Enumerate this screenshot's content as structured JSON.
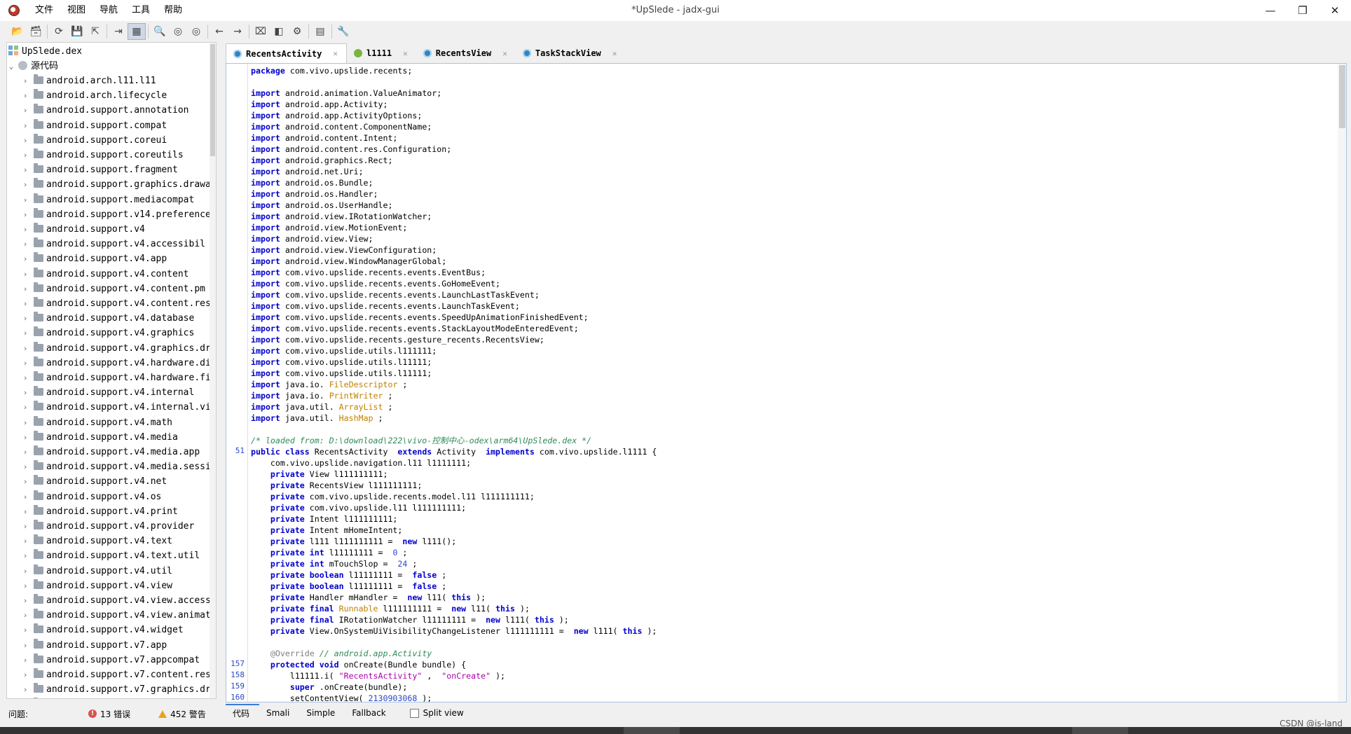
{
  "window": {
    "title": "*UpSlede - jadx-gui"
  },
  "menu": [
    "文件",
    "视图",
    "导航",
    "工具",
    "帮助"
  ],
  "window_controls": {
    "minimize": "—",
    "restore": "❐",
    "close": "✕"
  },
  "toolbar": {
    "icons": [
      "open-icon",
      "add-files-icon",
      "refresh-icon",
      "save-icon",
      "export-icon",
      "sync-tree-icon",
      "flatten-packages-icon",
      "search-icon",
      "find-class-icon",
      "find-usage-icon",
      "back-icon",
      "forward-icon",
      "deobfuscation-icon",
      "auto-save-icon",
      "debug-icon",
      "log-viewer-icon",
      "preferences-icon"
    ],
    "glyphs": [
      "📂",
      "🗃",
      "⟳",
      "💾",
      "⇱",
      "⇥",
      "▦",
      "🔍",
      "◎",
      "◎",
      "←",
      "→",
      "⌧",
      "◧",
      "⚙",
      "▤",
      "🔧"
    ]
  },
  "tree": {
    "root": "UpSlede.dex",
    "source": "源代码",
    "packages": [
      "android.arch.l11.l11",
      "android.arch.lifecycle",
      "android.support.annotation",
      "android.support.compat",
      "android.support.coreui",
      "android.support.coreutils",
      "android.support.fragment",
      "android.support.graphics.drawa",
      "android.support.mediacompat",
      "android.support.v14.preference",
      "android.support.v4",
      "android.support.v4.accessibil",
      "android.support.v4.app",
      "android.support.v4.content",
      "android.support.v4.content.pm",
      "android.support.v4.content.res",
      "android.support.v4.database",
      "android.support.v4.graphics",
      "android.support.v4.graphics.dr",
      "android.support.v4.hardware.di",
      "android.support.v4.hardware.fi",
      "android.support.v4.internal",
      "android.support.v4.internal.vi",
      "android.support.v4.math",
      "android.support.v4.media",
      "android.support.v4.media.app",
      "android.support.v4.media.sessi",
      "android.support.v4.net",
      "android.support.v4.os",
      "android.support.v4.print",
      "android.support.v4.provider",
      "android.support.v4.text",
      "android.support.v4.text.util",
      "android.support.v4.util",
      "android.support.v4.view",
      "android.support.v4.view.access",
      "android.support.v4.view.animat",
      "android.support.v4.widget",
      "android.support.v7.app",
      "android.support.v7.appcompat",
      "android.support.v7.content.res",
      "android.support.v7.graphics.dr",
      "android.support.v7.internal"
    ]
  },
  "tabs": [
    {
      "label": "RecentsActivity",
      "icon": "c",
      "active": true
    },
    {
      "label": "l1111",
      "icon": "i",
      "active": false
    },
    {
      "label": "RecentsView",
      "icon": "c",
      "active": false
    },
    {
      "label": "TaskStackView",
      "icon": "c",
      "active": false
    }
  ],
  "code": {
    "lines": [
      [
        "",
        [
          [
            "kw",
            "package"
          ],
          [
            "",
            "com.vivo.upslide.recents;"
          ]
        ]
      ],
      [
        "",
        []
      ],
      [
        "",
        [
          [
            "kw",
            "import"
          ],
          [
            "",
            "android.animation.ValueAnimator;"
          ]
        ]
      ],
      [
        "",
        [
          [
            "kw",
            "import"
          ],
          [
            "",
            "android.app.Activity;"
          ]
        ]
      ],
      [
        "",
        [
          [
            "kw",
            "import"
          ],
          [
            "",
            "android.app.ActivityOptions;"
          ]
        ]
      ],
      [
        "",
        [
          [
            "kw",
            "import"
          ],
          [
            "",
            "android.content.ComponentName;"
          ]
        ]
      ],
      [
        "",
        [
          [
            "kw",
            "import"
          ],
          [
            "",
            "android.content.Intent;"
          ]
        ]
      ],
      [
        "",
        [
          [
            "kw",
            "import"
          ],
          [
            "",
            "android.content.res.Configuration;"
          ]
        ]
      ],
      [
        "",
        [
          [
            "kw",
            "import"
          ],
          [
            "",
            "android.graphics.Rect;"
          ]
        ]
      ],
      [
        "",
        [
          [
            "kw",
            "import"
          ],
          [
            "",
            "android.net.Uri;"
          ]
        ]
      ],
      [
        "",
        [
          [
            "kw",
            "import"
          ],
          [
            "",
            "android.os.Bundle;"
          ]
        ]
      ],
      [
        "",
        [
          [
            "kw",
            "import"
          ],
          [
            "",
            "android.os.Handler;"
          ]
        ]
      ],
      [
        "",
        [
          [
            "kw",
            "import"
          ],
          [
            "",
            "android.os.UserHandle;"
          ]
        ]
      ],
      [
        "",
        [
          [
            "kw",
            "import"
          ],
          [
            "",
            "android.view.IRotationWatcher;"
          ]
        ]
      ],
      [
        "",
        [
          [
            "kw",
            "import"
          ],
          [
            "",
            "android.view.MotionEvent;"
          ]
        ]
      ],
      [
        "",
        [
          [
            "kw",
            "import"
          ],
          [
            "",
            "android.view.View;"
          ]
        ]
      ],
      [
        "",
        [
          [
            "kw",
            "import"
          ],
          [
            "",
            "android.view.ViewConfiguration;"
          ]
        ]
      ],
      [
        "",
        [
          [
            "kw",
            "import"
          ],
          [
            "",
            "android.view.WindowManagerGlobal;"
          ]
        ]
      ],
      [
        "",
        [
          [
            "kw",
            "import"
          ],
          [
            "",
            "com.vivo.upslide.recents.events.EventBus;"
          ]
        ]
      ],
      [
        "",
        [
          [
            "kw",
            "import"
          ],
          [
            "",
            "com.vivo.upslide.recents.events.GoHomeEvent;"
          ]
        ]
      ],
      [
        "",
        [
          [
            "kw",
            "import"
          ],
          [
            "",
            "com.vivo.upslide.recents.events.LaunchLastTaskEvent;"
          ]
        ]
      ],
      [
        "",
        [
          [
            "kw",
            "import"
          ],
          [
            "",
            "com.vivo.upslide.recents.events.LaunchTaskEvent;"
          ]
        ]
      ],
      [
        "",
        [
          [
            "kw",
            "import"
          ],
          [
            "",
            "com.vivo.upslide.recents.events.SpeedUpAnimationFinishedEvent;"
          ]
        ]
      ],
      [
        "",
        [
          [
            "kw",
            "import"
          ],
          [
            "",
            "com.vivo.upslide.recents.events.StackLayoutModeEnteredEvent;"
          ]
        ]
      ],
      [
        "",
        [
          [
            "kw",
            "import"
          ],
          [
            "",
            "com.vivo.upslide.recents.gesture_recents.RecentsView;"
          ]
        ]
      ],
      [
        "",
        [
          [
            "kw",
            "import"
          ],
          [
            "",
            "com.vivo.upslide.utils.l111111;"
          ]
        ]
      ],
      [
        "",
        [
          [
            "kw",
            "import"
          ],
          [
            "",
            "com.vivo.upslide.utils.l11111;"
          ]
        ]
      ],
      [
        "",
        [
          [
            "kw",
            "import"
          ],
          [
            "",
            "com.vivo.upslide.utils.l11111;"
          ]
        ]
      ],
      [
        "",
        [
          [
            "kw",
            "import"
          ],
          [
            "",
            "java.io."
          ],
          [
            "ty",
            "FileDescriptor"
          ],
          [
            "",
            ";"
          ]
        ]
      ],
      [
        "",
        [
          [
            "kw",
            "import"
          ],
          [
            "",
            "java.io."
          ],
          [
            "ty",
            "PrintWriter"
          ],
          [
            "",
            ";"
          ]
        ]
      ],
      [
        "",
        [
          [
            "kw",
            "import"
          ],
          [
            "",
            "java.util."
          ],
          [
            "ty",
            "ArrayList"
          ],
          [
            "",
            ";"
          ]
        ]
      ],
      [
        "",
        [
          [
            "kw",
            "import"
          ],
          [
            "",
            "java.util."
          ],
          [
            "ty",
            "HashMap"
          ],
          [
            "",
            ";"
          ]
        ]
      ],
      [
        "",
        []
      ],
      [
        "",
        [
          [
            "cm",
            "/* loaded from: D:\\download\\222\\vivo-控制中心-odex\\arm64\\UpSlede.dex */"
          ]
        ]
      ],
      [
        "51",
        [
          [
            "kw",
            "public class"
          ],
          [
            "",
            "RecentsActivity "
          ],
          [
            "kw",
            "extends"
          ],
          [
            "",
            "Activity "
          ],
          [
            "kw",
            "implements"
          ],
          [
            "",
            "com.vivo.upslide.l1111 {"
          ]
        ]
      ],
      [
        "",
        [
          [
            "",
            "    com.vivo.upslide.navigation.l11 l1111111;"
          ]
        ]
      ],
      [
        "",
        [
          [
            "kw",
            "    private"
          ],
          [
            "",
            "View l111111111;"
          ]
        ]
      ],
      [
        "",
        [
          [
            "kw",
            "    private"
          ],
          [
            "",
            "RecentsView l111111111;"
          ]
        ]
      ],
      [
        "",
        [
          [
            "kw",
            "    private"
          ],
          [
            "",
            "com.vivo.upslide.recents.model.l11 l111111111;"
          ]
        ]
      ],
      [
        "",
        [
          [
            "kw",
            "    private"
          ],
          [
            "",
            "com.vivo.upslide.l11 l111111111;"
          ]
        ]
      ],
      [
        "",
        [
          [
            "kw",
            "    private"
          ],
          [
            "",
            "Intent l111111111;"
          ]
        ]
      ],
      [
        "",
        [
          [
            "kw",
            "    private"
          ],
          [
            "",
            "Intent mHomeIntent;"
          ]
        ]
      ],
      [
        "",
        [
          [
            "kw",
            "    private"
          ],
          [
            "",
            "l111 l111111111 = "
          ],
          [
            "kw",
            "new"
          ],
          [
            "",
            "l111();"
          ]
        ]
      ],
      [
        "",
        [
          [
            "kw",
            "    private int"
          ],
          [
            "",
            "l11111111 = "
          ],
          [
            "num",
            "0"
          ],
          [
            "",
            ";"
          ]
        ]
      ],
      [
        "",
        [
          [
            "kw",
            "    private int"
          ],
          [
            "",
            "mTouchSlop = "
          ],
          [
            "num",
            "24"
          ],
          [
            "",
            ";"
          ]
        ]
      ],
      [
        "",
        [
          [
            "kw",
            "    private boolean"
          ],
          [
            "",
            "l11111111 = "
          ],
          [
            "kw",
            "false"
          ],
          [
            "",
            ";"
          ]
        ]
      ],
      [
        "",
        [
          [
            "kw",
            "    private boolean"
          ],
          [
            "",
            "l11111111 = "
          ],
          [
            "kw",
            "false"
          ],
          [
            "",
            ";"
          ]
        ]
      ],
      [
        "",
        [
          [
            "kw",
            "    private"
          ],
          [
            "",
            "Handler mHandler = "
          ],
          [
            "kw",
            "new"
          ],
          [
            "",
            "l11("
          ],
          [
            "kw",
            "this"
          ],
          [
            "",
            ");"
          ]
        ]
      ],
      [
        "",
        [
          [
            "kw",
            "    private final"
          ],
          [
            "ty",
            "Runnable"
          ],
          [
            "",
            "l111111111 = "
          ],
          [
            "kw",
            "new"
          ],
          [
            "",
            "l11("
          ],
          [
            "kw",
            "this"
          ],
          [
            "",
            ");"
          ]
        ]
      ],
      [
        "",
        [
          [
            "kw",
            "    private final"
          ],
          [
            "",
            "IRotationWatcher l11111111 = "
          ],
          [
            "kw",
            "new"
          ],
          [
            "",
            "l111("
          ],
          [
            "kw",
            "this"
          ],
          [
            "",
            ");"
          ]
        ]
      ],
      [
        "",
        [
          [
            "kw",
            "    private"
          ],
          [
            "",
            "View.OnSystemUiVisibilityChangeListener l111111111 = "
          ],
          [
            "kw",
            "new"
          ],
          [
            "",
            "l111("
          ],
          [
            "kw",
            "this"
          ],
          [
            "",
            ");"
          ]
        ]
      ],
      [
        "",
        []
      ],
      [
        "",
        [
          [
            "ann",
            "    @Override"
          ],
          [
            "cm",
            "// android.app.Activity"
          ]
        ]
      ],
      [
        "157",
        [
          [
            "kw",
            "    protected void"
          ],
          [
            "",
            "onCreate(Bundle bundle) {"
          ]
        ]
      ],
      [
        "158",
        [
          [
            "",
            "        l11111.i("
          ],
          [
            "str",
            "\"RecentsActivity\""
          ],
          [
            "",
            ", "
          ],
          [
            "str",
            "\"onCreate\""
          ],
          [
            "",
            ");"
          ]
        ]
      ],
      [
        "159",
        [
          [
            "kw",
            "        super"
          ],
          [
            "",
            ".onCreate(bundle);"
          ]
        ]
      ],
      [
        "160",
        [
          [
            "",
            "        setContentView("
          ],
          [
            "num",
            "2130903068"
          ],
          [
            "",
            ");"
          ]
        ]
      ]
    ]
  },
  "view_tabs": [
    "代码",
    "Smali",
    "Simple",
    "Fallback"
  ],
  "split_view_label": "Split view",
  "status": {
    "problems_label": "问题:",
    "errors": "13 错误",
    "warnings": "452 警告"
  },
  "watermark": "CSDN @is-land"
}
